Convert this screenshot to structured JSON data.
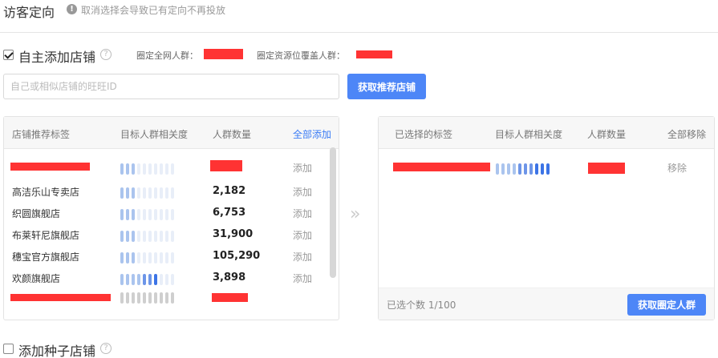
{
  "header": {
    "title": "访客定向",
    "tip": "取消选择会导致已有定向不再投放"
  },
  "self_add": {
    "label": "自主添加店铺",
    "checked": true,
    "fixed_network_label": "圈定全网人群：",
    "fixed_resource_label": "圈定资源位覆盖人群："
  },
  "search": {
    "placeholder": "自己或相似店铺的旺旺ID",
    "button_label": "获取推荐店铺"
  },
  "left_panel": {
    "headers": [
      "店铺推荐标签",
      "目标人群相关度",
      "人群数量",
      "全部添加"
    ],
    "add_all_color": "#3b7cf5",
    "rows": [
      {
        "name": "",
        "count": "",
        "action": "添加",
        "relevance": 0.3
      },
      {
        "name": "高洁乐山专卖店",
        "count": "2,182",
        "action": "添加",
        "relevance": 0.3
      },
      {
        "name": "织圆旗舰店",
        "count": "6,753",
        "action": "添加",
        "relevance": 0.3
      },
      {
        "name": "布莱轩尼旗舰店",
        "count": "31,900",
        "action": "添加",
        "relevance": 0.3
      },
      {
        "name": "穗宝官方旗舰店",
        "count": "105,290",
        "action": "添加",
        "relevance": 0.3
      },
      {
        "name": "欢颜旗舰店",
        "count": "3,898",
        "action": "添加",
        "relevance": 0.7
      },
      {
        "name": "",
        "count": "",
        "action": "",
        "relevance": 0
      }
    ]
  },
  "right_panel": {
    "headers": [
      "已选择的标签",
      "目标人群相关度",
      "人群数量",
      "全部移除"
    ],
    "rows": [
      {
        "name": "",
        "count": "",
        "action": "移除",
        "relevance": 0.8
      }
    ],
    "selected_count": "已选个数 1/100",
    "button_label": "获取圈定人群"
  },
  "seed": {
    "label": "添加种子店铺",
    "checked": false
  },
  "icons": {
    "tip": "info-icon",
    "help": "question-icon",
    "transfer": "double-chevron-right-icon"
  },
  "colors": {
    "primary": "#4d86f7",
    "redaction": "#ff3333"
  }
}
